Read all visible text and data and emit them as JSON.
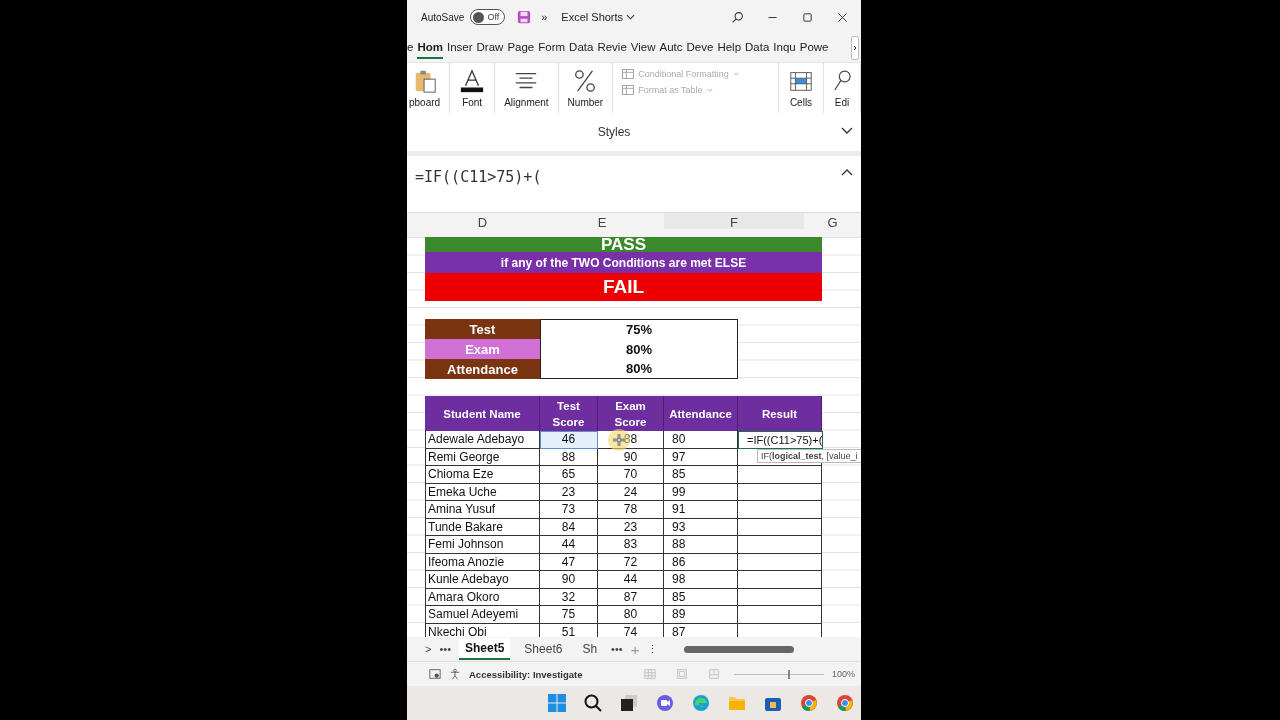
{
  "titlebar": {
    "autosave_label": "AutoSave",
    "autosave": {
      "on": false,
      "label": "Off"
    },
    "more": "»",
    "title": "Excel Shorts"
  },
  "ribbon_tabs": [
    {
      "label": "e",
      "selected": false
    },
    {
      "label": "Hom",
      "selected": true
    },
    {
      "label": "Inser",
      "selected": false
    },
    {
      "label": "Draw",
      "selected": false
    },
    {
      "label": "Page",
      "selected": false
    },
    {
      "label": "Form",
      "selected": false
    },
    {
      "label": "Data",
      "selected": false
    },
    {
      "label": "Revie",
      "selected": false
    },
    {
      "label": "View",
      "selected": false
    },
    {
      "label": "Autc",
      "selected": false
    },
    {
      "label": "Deve",
      "selected": false
    },
    {
      "label": "Help",
      "selected": false
    },
    {
      "label": "Data",
      "selected": false
    },
    {
      "label": "Inqu",
      "selected": false
    },
    {
      "label": "Powe",
      "selected": false
    }
  ],
  "ribbon_groups": [
    {
      "kind": "clipboard",
      "label": "pboard"
    },
    {
      "kind": "font",
      "label": "Font"
    },
    {
      "kind": "alignment",
      "label": "Alignment"
    },
    {
      "kind": "number",
      "label": "Number"
    },
    {
      "kind": "styles",
      "items": [
        {
          "label": "Conditional Formatting",
          "disabled": true
        },
        {
          "label": "Format as Table",
          "disabled": true
        }
      ]
    },
    {
      "kind": "cells",
      "label": "Cells"
    },
    {
      "kind": "editing",
      "label": "Edi"
    }
  ],
  "styles_label": "Styles",
  "formula": "=IF((C11>75)+(",
  "column_headers": [
    "D",
    "E",
    "F",
    "G"
  ],
  "banner": [
    {
      "kind": "pass",
      "text": "PASS"
    },
    {
      "kind": "note",
      "text": "if any of the TWO Conditions are met ELSE"
    },
    {
      "kind": "fail",
      "text": "FAIL"
    }
  ],
  "criteria": [
    {
      "label": "Test",
      "value": "75%",
      "color": "#7a3510"
    },
    {
      "label": "Exam",
      "value": "80%",
      "color": "#d16fd4"
    },
    {
      "label": "Attendance",
      "value": "80%",
      "color": "#7a3510"
    }
  ],
  "table": {
    "columns": [
      "Student Name",
      "Test Score",
      "Exam Score",
      "Attendance",
      "Result"
    ],
    "rows": [
      {
        "name": "Adewale Adebayo",
        "test": "46",
        "exam": "88",
        "attendance": "80",
        "result": "=IF((C11>75)+(",
        "test_selected": true
      },
      {
        "name": "Remi George",
        "test": "88",
        "exam": "90",
        "attendance": "97",
        "test_selected": false
      },
      {
        "name": "Chioma Eze",
        "test": "65",
        "exam": "70",
        "attendance": "85",
        "test_selected": false
      },
      {
        "name": "Emeka Uche",
        "test": "23",
        "exam": "24",
        "attendance": "99",
        "test_selected": false
      },
      {
        "name": "Amina Yusuf",
        "test": "73",
        "exam": "78",
        "attendance": "91",
        "test_selected": false
      },
      {
        "name": "Tunde Bakare",
        "test": "84",
        "exam": "23",
        "attendance": "93",
        "test_selected": false
      },
      {
        "name": "Femi Johnson",
        "test": "44",
        "exam": "83",
        "attendance": "88",
        "test_selected": false
      },
      {
        "name": "Ifeoma Anozie",
        "test": "47",
        "exam": "72",
        "attendance": "86",
        "test_selected": false
      },
      {
        "name": "Kunle Adebayo",
        "test": "90",
        "exam": "44",
        "attendance": "98",
        "test_selected": false
      },
      {
        "name": "Amara Okoro",
        "test": "32",
        "exam": "87",
        "attendance": "85",
        "test_selected": false
      },
      {
        "name": "Samuel Adeyemi",
        "test": "75",
        "exam": "80",
        "attendance": "89",
        "test_selected": false
      },
      {
        "name": "Nkechi Obi",
        "test": "51",
        "exam": "74",
        "attendance": "87",
        "test_selected": false
      }
    ],
    "tooltip": "IF(**logical_test**, [value_i"
  },
  "sheet_nav": [
    ">",
    "•••"
  ],
  "sheets": [
    {
      "label": "Sheet5",
      "selected": true
    },
    {
      "label": "Sheet6",
      "selected": false
    },
    {
      "label": "Sh",
      "selected": false
    }
  ],
  "sheet_more": "•••",
  "add_sheet": "+",
  "sheet_menu": "⋮",
  "status": {
    "accessibility": "Accessibility: Investigate",
    "zoom": "100%",
    "zoom_slider": {
      "level": 0.6
    }
  }
}
